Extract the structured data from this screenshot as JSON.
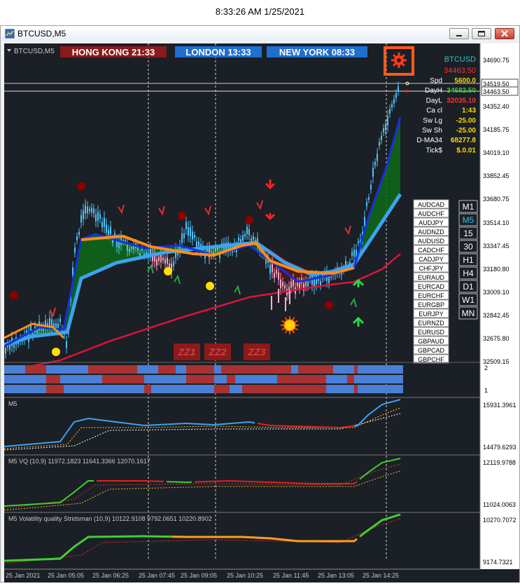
{
  "clock": "8:33:26 AM 1/25/2021",
  "window": {
    "title": "BTCUSD,M5"
  },
  "symbol_label": "BTCUSD,M5",
  "sessions": [
    {
      "name": "HONG KONG",
      "time": "21:33",
      "color": "#8b1a1a"
    },
    {
      "name": "LONDON",
      "time": "13:33",
      "color": "#1e6fd0"
    },
    {
      "name": "NEW YORK",
      "time": "08:33",
      "color": "#1e6fd0"
    }
  ],
  "info_panel": {
    "symbol": "BTCUSD",
    "price": "34463.50",
    "rows": [
      {
        "label": "Spd",
        "value": "5600.0",
        "color": "#ffd700"
      },
      {
        "label": "DayH",
        "value": "34682.50",
        "color": "#32cd32"
      },
      {
        "label": "DayL",
        "value": "32035.10",
        "color": "#ff3030"
      },
      {
        "label": "Ca cl",
        "value": "1:43",
        "color": "#ffd700"
      },
      {
        "label": "Sw Lg",
        "value": "-25.00",
        "color": "#ffd700"
      },
      {
        "label": "Sw Sh",
        "value": "-25.00",
        "color": "#ffd700"
      },
      {
        "label": "D-MA34",
        "value": "68277.8",
        "color": "#ffd700"
      },
      {
        "label": "Tick$",
        "value": "$.0.01",
        "color": "#ffd700"
      }
    ]
  },
  "price_axis": [
    "34690.75",
    "34519.50",
    "34463.50",
    "34352.40",
    "34185.75",
    "34019.10",
    "33852.45",
    "33680.75",
    "33514.10",
    "33347.45",
    "33180.80",
    "33009.10",
    "32842.45",
    "32675.80",
    "32509.15"
  ],
  "symbols": [
    "AUDCAD",
    "AUDCHF",
    "AUDJPY",
    "AUDNZD",
    "AUDUSD",
    "CADCHF",
    "CADJPY",
    "CHFJPY",
    "EURAUD",
    "EURCAD",
    "EURCHF",
    "EURGBP",
    "EURJPY",
    "EURNZD",
    "EURUSD",
    "GBPAUD",
    "GBPCAD",
    "GBPCHF"
  ],
  "timeframes": [
    "M1",
    "M5",
    "15",
    "30",
    "H1",
    "H4",
    "D1",
    "W1",
    "MN"
  ],
  "active_timeframe": "M5",
  "zz_labels": [
    "ZZ1",
    "ZZ2",
    "ZZ3"
  ],
  "strength_axis": [
    "2",
    "1"
  ],
  "sub1": {
    "label": "M5",
    "axis_top": "15931.3961",
    "axis_bottom": "14479.6293"
  },
  "sub2": {
    "label": "M5 VQ (10,9) 11972.1823 11641.3366 12070.1617",
    "axis_top": "12119.9788",
    "axis_bottom": "11024.0063"
  },
  "sub3": {
    "label": "M5 Volatility quality Stridsman (10,9) 10122.9108 9792.0651 10220.8902",
    "axis_top": "10270.7072",
    "axis_bottom": "9174.7321"
  },
  "time_axis": [
    "25 Jan 2021",
    "25 Jan 05:05",
    "25 Jan 06:25",
    "25 Jan 07:45",
    "25 Jan 09:05",
    "25 Jan 10:25",
    "25 Jan 11:45",
    "25 Jan 13:05",
    "25 Jan 14:25"
  ]
}
